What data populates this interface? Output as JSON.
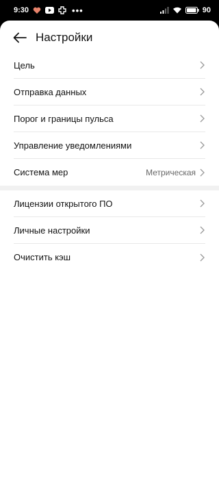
{
  "status_bar": {
    "time": "9:30",
    "battery": "90"
  },
  "header": {
    "title": "Настройки"
  },
  "group1": [
    {
      "label": "Цель",
      "value": ""
    },
    {
      "label": "Отправка данных",
      "value": ""
    },
    {
      "label": "Порог и границы пульса",
      "value": ""
    },
    {
      "label": "Управление уведомлениями",
      "value": ""
    },
    {
      "label": "Система мер",
      "value": "Метрическая"
    }
  ],
  "group2": [
    {
      "label": "Лицензии открытого ПО",
      "value": ""
    },
    {
      "label": "Личные настройки",
      "value": ""
    },
    {
      "label": "Очистить кэш",
      "value": ""
    }
  ],
  "colors": {
    "background": "#ffffff",
    "divider": "#e8e8e8",
    "section_gap": "#f1f1f1",
    "secondary_text": "#666666"
  }
}
